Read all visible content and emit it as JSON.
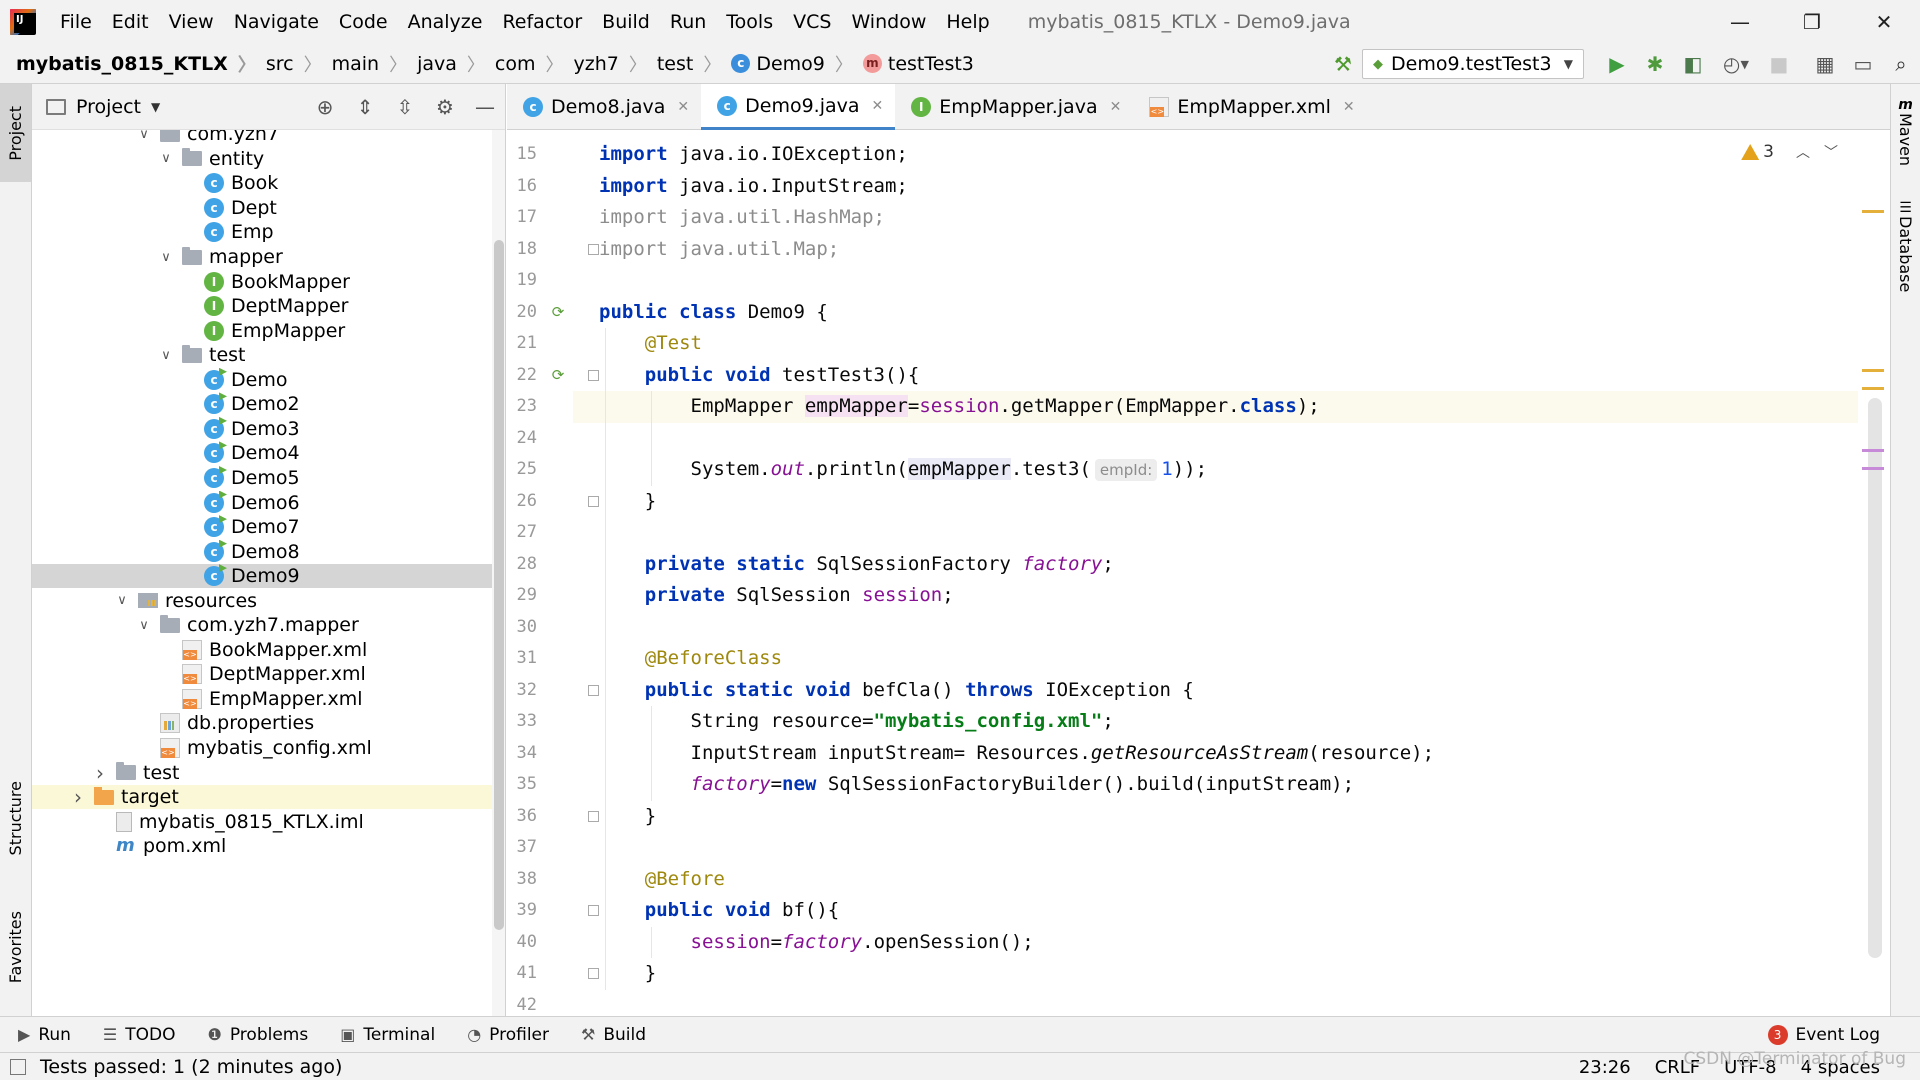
{
  "window": {
    "title": "mybatis_0815_KTLX - Demo9.java",
    "menu": [
      "File",
      "Edit",
      "View",
      "Navigate",
      "Code",
      "Analyze",
      "Refactor",
      "Build",
      "Run",
      "Tools",
      "VCS",
      "Window",
      "Help"
    ],
    "controls": {
      "minimize": "—",
      "restore": "❐",
      "close": "✕"
    }
  },
  "navbar": {
    "breadcrumbs": [
      "mybatis_0815_KTLX",
      "src",
      "main",
      "java",
      "com",
      "yzh7",
      "test",
      "Demo9",
      "testTest3"
    ],
    "run_config": "Demo9.testTest3"
  },
  "left_stripe": {
    "project": "Project",
    "structure": "Structure",
    "favorites": "Favorites"
  },
  "right_stripe": {
    "maven": "Maven",
    "database": "Database"
  },
  "project_panel": {
    "title": "Project",
    "tree": [
      {
        "label": "com.yzh7",
        "icon": "folder",
        "indent": 4,
        "twisty": "expanded"
      },
      {
        "label": "entity",
        "icon": "folder",
        "indent": 5,
        "twisty": "expanded"
      },
      {
        "label": "Book",
        "icon": "class",
        "indent": 6
      },
      {
        "label": "Dept",
        "icon": "class",
        "indent": 6
      },
      {
        "label": "Emp",
        "icon": "class",
        "indent": 6
      },
      {
        "label": "mapper",
        "icon": "folder",
        "indent": 5,
        "twisty": "expanded"
      },
      {
        "label": "BookMapper",
        "icon": "interface",
        "indent": 6
      },
      {
        "label": "DeptMapper",
        "icon": "interface",
        "indent": 6
      },
      {
        "label": "EmpMapper",
        "icon": "interface",
        "indent": 6
      },
      {
        "label": "test",
        "icon": "folder",
        "indent": 5,
        "twisty": "expanded"
      },
      {
        "label": "Demo",
        "icon": "test-class",
        "indent": 6
      },
      {
        "label": "Demo2",
        "icon": "test-class",
        "indent": 6
      },
      {
        "label": "Demo3",
        "icon": "test-class",
        "indent": 6
      },
      {
        "label": "Demo4",
        "icon": "test-class",
        "indent": 6
      },
      {
        "label": "Demo5",
        "icon": "test-class",
        "indent": 6
      },
      {
        "label": "Demo6",
        "icon": "test-class",
        "indent": 6
      },
      {
        "label": "Demo7",
        "icon": "test-class",
        "indent": 6
      },
      {
        "label": "Demo8",
        "icon": "test-class",
        "indent": 6
      },
      {
        "label": "Demo9",
        "icon": "test-class",
        "indent": 6,
        "selected": true
      },
      {
        "label": "resources",
        "icon": "resources-folder",
        "indent": 3,
        "twisty": "expanded"
      },
      {
        "label": "com.yzh7.mapper",
        "icon": "folder",
        "indent": 4,
        "twisty": "expanded"
      },
      {
        "label": "BookMapper.xml",
        "icon": "xml",
        "indent": 5
      },
      {
        "label": "DeptMapper.xml",
        "icon": "xml",
        "indent": 5
      },
      {
        "label": "EmpMapper.xml",
        "icon": "xml",
        "indent": 5
      },
      {
        "label": "db.properties",
        "icon": "properties",
        "indent": 4
      },
      {
        "label": "mybatis_config.xml",
        "icon": "xml",
        "indent": 4
      },
      {
        "label": "test",
        "icon": "folder",
        "indent": 2,
        "twisty": "collapsed"
      },
      {
        "label": "target",
        "icon": "folder-orange",
        "indent": 1,
        "twisty": "collapsed",
        "highlight": true
      },
      {
        "label": "mybatis_0815_KTLX.iml",
        "icon": "iml",
        "indent": 2
      },
      {
        "label": "pom.xml",
        "icon": "maven",
        "indent": 2
      }
    ]
  },
  "editor": {
    "tabs": [
      {
        "label": "Demo8.java",
        "icon": "class"
      },
      {
        "label": "Demo9.java",
        "icon": "class",
        "active": true
      },
      {
        "label": "EmpMapper.java",
        "icon": "interface"
      },
      {
        "label": "EmpMapper.xml",
        "icon": "xml"
      }
    ],
    "inspection": {
      "warnings": "3"
    },
    "first_line": 15,
    "caret_line": 23,
    "run_gutter_lines": [
      20,
      22
    ],
    "fold_lines": [
      18,
      22,
      26,
      32,
      36,
      39,
      41
    ],
    "lines": [
      [
        [
          "kw",
          "import"
        ],
        [
          "t",
          " java.io.IOException;"
        ]
      ],
      [
        [
          "kw",
          "import"
        ],
        [
          "t",
          " java.io.InputStream;"
        ]
      ],
      [
        [
          "gray",
          "import java.util.HashMap;"
        ]
      ],
      [
        [
          "gray",
          "import java.util.Map;"
        ]
      ],
      [],
      [
        [
          "kw",
          "public class"
        ],
        [
          "t",
          " Demo9 {"
        ]
      ],
      [
        [
          "t",
          "    "
        ],
        [
          "ann",
          "@Test"
        ]
      ],
      [
        [
          "t",
          "    "
        ],
        [
          "kw",
          "public void"
        ],
        [
          "t",
          " testTest3(){"
        ]
      ],
      [
        [
          "t",
          "        EmpMapper "
        ],
        [
          "hlw",
          "empMapper"
        ],
        [
          "t",
          "="
        ],
        [
          "fld",
          "session"
        ],
        [
          "t",
          ".getMapper(EmpMapper."
        ],
        [
          "kw",
          "class"
        ],
        [
          "t",
          ");"
        ]
      ],
      [],
      [
        [
          "t",
          "        System."
        ],
        [
          "sfld",
          "out"
        ],
        [
          "t",
          ".println("
        ],
        [
          "hlr",
          "empMapper"
        ],
        [
          "t",
          ".test3("
        ],
        [
          "hint",
          "empId:"
        ],
        [
          "num",
          "1"
        ],
        [
          "t",
          "));"
        ]
      ],
      [
        [
          "t",
          "    }"
        ]
      ],
      [],
      [
        [
          "t",
          "    "
        ],
        [
          "kw",
          "private static"
        ],
        [
          "t",
          " SqlSessionFactory "
        ],
        [
          "sfld",
          "factory"
        ],
        [
          "t",
          ";"
        ]
      ],
      [
        [
          "t",
          "    "
        ],
        [
          "kw",
          "private"
        ],
        [
          "t",
          " SqlSession "
        ],
        [
          "fld",
          "session"
        ],
        [
          "t",
          ";"
        ]
      ],
      [],
      [
        [
          "t",
          "    "
        ],
        [
          "ann",
          "@BeforeClass"
        ]
      ],
      [
        [
          "t",
          "    "
        ],
        [
          "kw",
          "public static void"
        ],
        [
          "t",
          " befCla() "
        ],
        [
          "kw",
          "throws"
        ],
        [
          "t",
          " IOException {"
        ]
      ],
      [
        [
          "t",
          "        String resource="
        ],
        [
          "str",
          "\"mybatis_config.xml\""
        ],
        [
          "t",
          ";"
        ]
      ],
      [
        [
          "t",
          "        InputStream inputStream= Resources."
        ],
        [
          "smeth",
          "getResourceAsStream"
        ],
        [
          "t",
          "(resource);"
        ]
      ],
      [
        [
          "t",
          "        "
        ],
        [
          "sfld",
          "factory"
        ],
        [
          "t",
          "="
        ],
        [
          "kw",
          "new"
        ],
        [
          "t",
          " SqlSessionFactoryBuilder().build(inputStream);"
        ]
      ],
      [
        [
          "t",
          "    }"
        ]
      ],
      [],
      [
        [
          "t",
          "    "
        ],
        [
          "ann",
          "@Before"
        ]
      ],
      [
        [
          "t",
          "    "
        ],
        [
          "kw",
          "public void"
        ],
        [
          "t",
          " bf(){"
        ]
      ],
      [
        [
          "t",
          "        "
        ],
        [
          "fld",
          "session"
        ],
        [
          "t",
          "="
        ],
        [
          "sfld",
          "factory"
        ],
        [
          "t",
          ".openSession();"
        ]
      ],
      [
        [
          "t",
          "    }"
        ]
      ],
      []
    ],
    "scroll_marks": [
      {
        "color": "#e5b03a",
        "pos": 0.09
      },
      {
        "color": "#e5b03a",
        "pos": 0.27
      },
      {
        "color": "#e5b03a",
        "pos": 0.29
      },
      {
        "color": "#c78ad8",
        "pos": 0.36
      },
      {
        "color": "#c78ad8",
        "pos": 0.38
      }
    ]
  },
  "bottom_tools": [
    {
      "label": "Run",
      "icon": "▶"
    },
    {
      "label": "TODO",
      "icon": "☰"
    },
    {
      "label": "Problems",
      "icon": "❶"
    },
    {
      "label": "Terminal",
      "icon": "▣"
    },
    {
      "label": "Profiler",
      "icon": "◔"
    },
    {
      "label": "Build",
      "icon": "⚒"
    }
  ],
  "event_log": {
    "label": "Event Log",
    "count": "3"
  },
  "status": {
    "message": "Tests passed: 1 (2 minutes ago)",
    "position": "23:26",
    "line_sep": "CRLF",
    "encoding": "UTF-8",
    "indent": "4 spaces",
    "watermark": "CSDN @Terminator of Bug"
  }
}
